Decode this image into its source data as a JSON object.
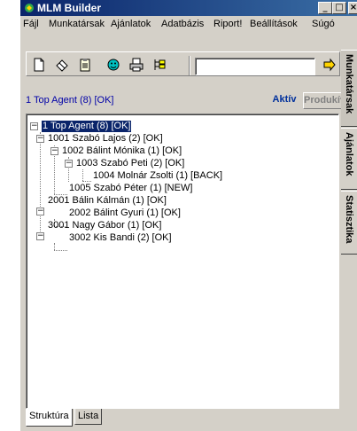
{
  "window": {
    "title": "MLM Builder",
    "controls": {
      "minimize": "_",
      "maximize": "□",
      "close": "×"
    }
  },
  "menu": [
    "Fájl",
    "Munkatársak",
    "Ajánlatok",
    "Adatbázis",
    "Riport!",
    "Beállítások",
    "Súgó"
  ],
  "toolbar": {
    "icons": [
      "new-document-icon",
      "eraser-icon",
      "clipboard-icon",
      "smiley-icon",
      "printer-icon",
      "tree-view-icon",
      "go-icon"
    ],
    "search_value": ""
  },
  "status": {
    "agent": "1 Top Agent (8) [OK]",
    "active_label": "Aktív",
    "production_label": "Produkív"
  },
  "tree": [
    {
      "label": "1 Top Agent (8) [OK]",
      "level": 0,
      "toggle": "−",
      "selected": true
    },
    {
      "label": "1001 Szabó Lajos (2) [OK]",
      "level": 1,
      "toggle": "−"
    },
    {
      "label": "1002 Bálint Mónika (1) [OK]",
      "level": 2,
      "toggle": "−"
    },
    {
      "label": "1003 Szabó Peti (2) [OK]",
      "level": 3,
      "toggle": "−"
    },
    {
      "label": "1004 Molnár Zsolti (1) [BACK]",
      "level": 4,
      "toggle": ""
    },
    {
      "label": "1005 Szabó Péter (1) [NEW]",
      "level": 2,
      "toggle": ""
    },
    {
      "label": "2001 Bálin Kálmán (1) [OK]",
      "level": 1,
      "toggle": "−"
    },
    {
      "label": "2002 Bálint Gyuri (1) [OK]",
      "level": 2,
      "toggle": ""
    },
    {
      "label": "3001 Nagy Gábor (1) [OK]",
      "level": 1,
      "toggle": "−"
    },
    {
      "label": "3002 Kis Bandi (2) [OK]",
      "level": 2,
      "toggle": ""
    }
  ],
  "bottom_tabs": [
    "Struktúra",
    "Lista"
  ],
  "side_tabs": [
    "Munkatársak",
    "Ajánlatok",
    "Statisztika"
  ],
  "colors": {
    "titlebar": "#0a246a",
    "selection": "#0a246a",
    "link": "#0000a8",
    "active": "#00309c"
  }
}
